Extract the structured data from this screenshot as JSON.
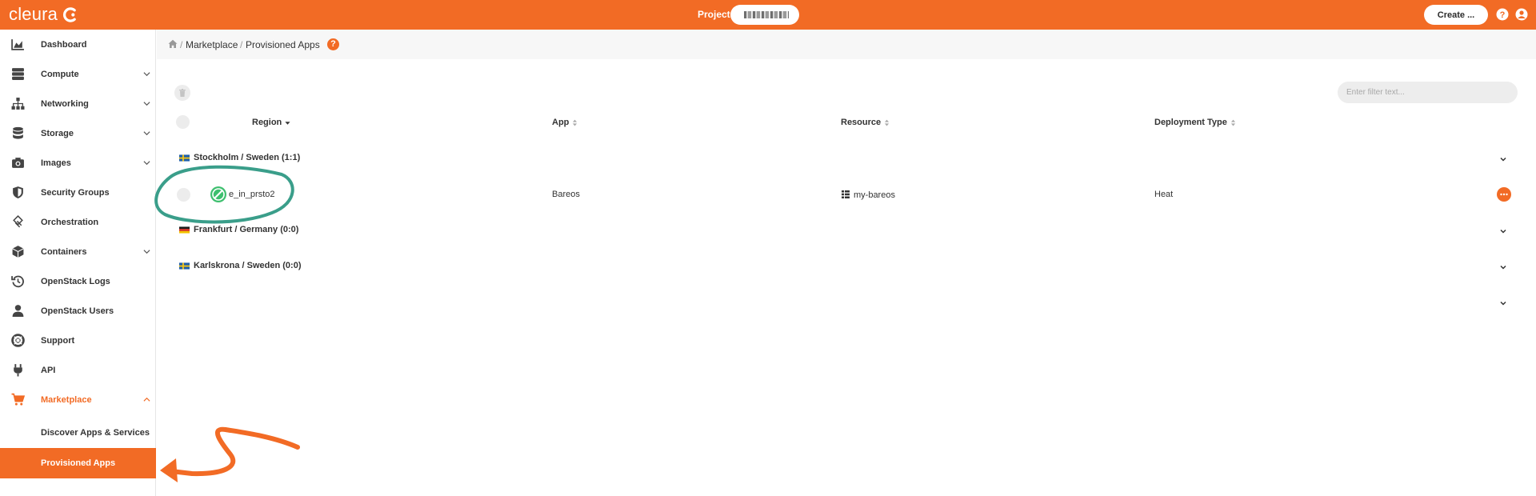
{
  "app": {
    "brand": "cleura",
    "accent": "#f26b25"
  },
  "header": {
    "project_label": "Project",
    "create_label": "Create ...",
    "help_icon": "help-circle-icon",
    "user_icon": "user-circle-icon"
  },
  "sidebar": {
    "items": [
      {
        "label": "Dashboard",
        "icon": "area-chart-icon",
        "expandable": false
      },
      {
        "label": "Compute",
        "icon": "server-icon",
        "expandable": true
      },
      {
        "label": "Networking",
        "icon": "sitemap-icon",
        "expandable": true
      },
      {
        "label": "Storage",
        "icon": "database-icon",
        "expandable": true
      },
      {
        "label": "Images",
        "icon": "camera-icon",
        "expandable": true
      },
      {
        "label": "Security Groups",
        "icon": "shield-icon",
        "expandable": false
      },
      {
        "label": "Orchestration",
        "icon": "orchestration-icon",
        "expandable": false
      },
      {
        "label": "Containers",
        "icon": "cube-icon",
        "expandable": true
      },
      {
        "label": "OpenStack Logs",
        "icon": "history-icon",
        "expandable": false
      },
      {
        "label": "OpenStack Users",
        "icon": "user-icon",
        "expandable": false
      },
      {
        "label": "Support",
        "icon": "lifebuoy-icon",
        "expandable": false
      },
      {
        "label": "API",
        "icon": "plug-icon",
        "expandable": false
      },
      {
        "label": "Marketplace",
        "icon": "cart-icon",
        "expandable": true,
        "expanded": true
      }
    ],
    "subitems": [
      {
        "label": "Discover Apps & Services",
        "selected": false
      },
      {
        "label": "Provisioned Apps",
        "selected": true
      }
    ]
  },
  "breadcrumb": {
    "items": [
      "Marketplace",
      "Provisioned Apps"
    ],
    "separator": "/"
  },
  "table": {
    "filter_placeholder": "Enter filter text...",
    "columns": [
      "Region",
      "App",
      "Resource",
      "Deployment Type"
    ],
    "groups": [
      {
        "label": "Stockholm / Sweden (1:1)",
        "flag": "sweden"
      },
      {
        "label": "Frankfurt / Germany (0:0)",
        "flag": "germany"
      },
      {
        "label": "Karlskrona / Sweden (0:0)",
        "flag": "sweden"
      }
    ],
    "rows": [
      {
        "name": "e_in_prsto2",
        "app": "Bareos",
        "resource": "my-bareos",
        "deployment_type": "Heat"
      }
    ]
  }
}
